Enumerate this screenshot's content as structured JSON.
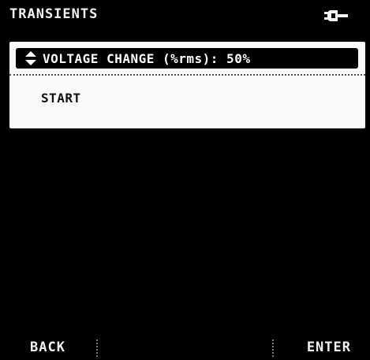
{
  "header": {
    "title": "TRANSIENTS",
    "power_icon": "plug-icon"
  },
  "menu": {
    "selected_item": {
      "icon": "up-down-icon",
      "label": "VOLTAGE CHANGE (%rms): 50%"
    },
    "items": [
      {
        "label": "START"
      }
    ]
  },
  "softkeys": {
    "back_label": "BACK",
    "enter_label": "ENTER"
  },
  "colors": {
    "background": "#000000",
    "panel": "#fafafa",
    "selection": "#000000",
    "text_light": "#f2f2f2",
    "text_dark": "#111111"
  }
}
